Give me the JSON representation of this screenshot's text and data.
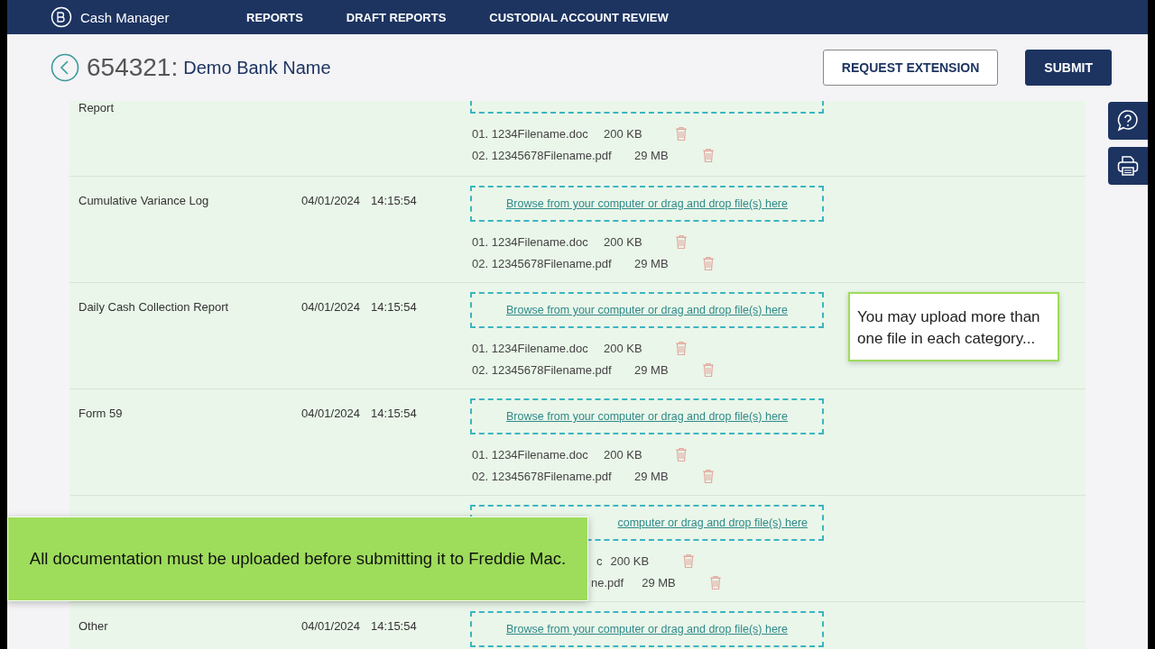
{
  "navbar": {
    "app_name": "Cash Manager",
    "links": [
      {
        "label": "REPORTS",
        "selected": false
      },
      {
        "label": "DRAFT REPORTS",
        "selected": false
      },
      {
        "label": "CUSTODIAL ACCOUNT REVIEW",
        "selected": false
      }
    ]
  },
  "header": {
    "number": "654321:",
    "bank_name": "Demo Bank Name",
    "buttons": [
      {
        "label": "REQUEST EXTENSION",
        "kind": "secondary"
      },
      {
        "label": "SUBMIT",
        "kind": "primary"
      }
    ]
  },
  "rows": [
    {
      "kind": "partial",
      "name": "Report",
      "files": [
        {
          "name": "01. 1234Filename.doc",
          "size": "200 KB"
        },
        {
          "name": "02. 12345678Filename.pdf",
          "size": "29 MB"
        }
      ]
    },
    {
      "kind": "full",
      "name": "Cumulative Variance Log",
      "date": "04/01/2024",
      "time": "14:15:54",
      "dropzone": "Browse from your computer or drag and drop file(s) here",
      "files": [
        {
          "name": "01. 1234Filename.doc",
          "size": "200 KB"
        },
        {
          "name": "02. 12345678Filename.pdf",
          "size": "29 MB"
        }
      ]
    },
    {
      "kind": "full",
      "name": "Daily Cash Collection Report",
      "date": "04/01/2024",
      "time": "14:15:54",
      "dropzone": "Browse from your computer or drag and drop file(s) here",
      "files": [
        {
          "name": "01. 1234Filename.doc",
          "size": "200 KB"
        },
        {
          "name": "02. 12345678Filename.pdf",
          "size": "29 MB"
        }
      ]
    },
    {
      "kind": "full",
      "name": "Form 59",
      "date": "04/01/2024",
      "time": "14:15:54",
      "dropzone": "Browse from your computer or drag and drop file(s) here",
      "files": [
        {
          "name": "01. 1234Filename.doc",
          "size": "200 KB"
        },
        {
          "name": "02. 12345678Filename.pdf",
          "size": "29 MB"
        }
      ]
    },
    {
      "kind": "covered",
      "dropzone": "computer or drag and drop file(s) here",
      "files": [
        {
          "name": "c",
          "size": "200 KB"
        },
        {
          "name": "ne.pdf",
          "size": "29 MB"
        }
      ]
    },
    {
      "kind": "full",
      "name": "Other",
      "date": "04/01/2024",
      "time": "14:15:54",
      "dropzone": "Browse from your computer or drag and drop file(s) here",
      "files": []
    }
  ],
  "tooltip": "You may upload more than one file in each category...",
  "banner": "All documentation must be uploaded before submitting it to Freddie Mac."
}
